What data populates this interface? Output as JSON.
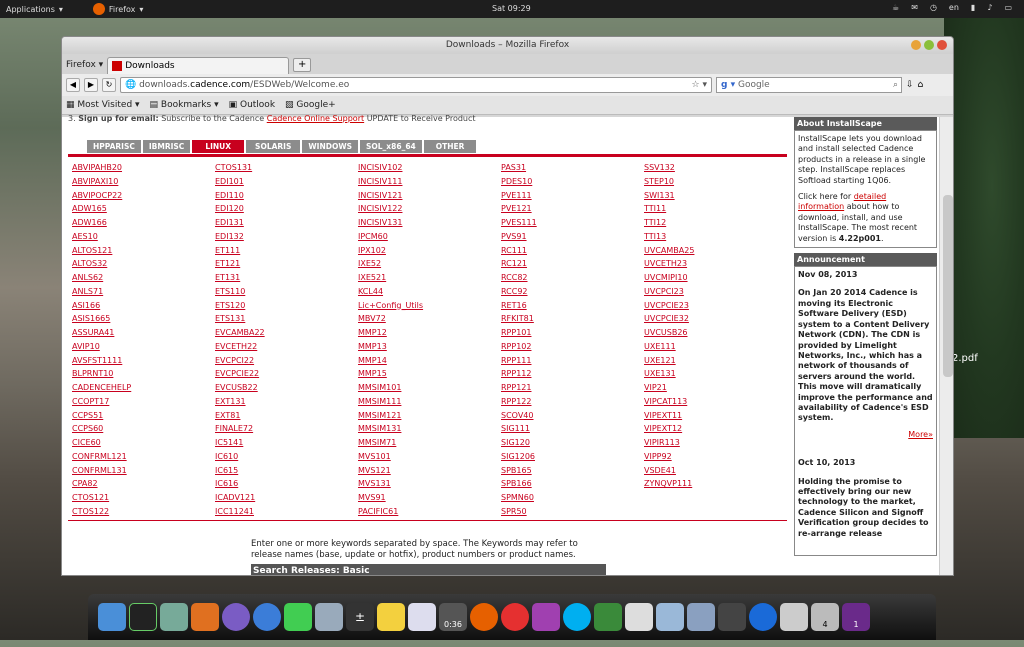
{
  "desktop": {
    "applications": "Applications",
    "firefox": "Firefox",
    "clock": "Sat 09:29",
    "lang": "en",
    "pdf_label": "2.pdf"
  },
  "window": {
    "title": "Downloads – Mozilla Firefox"
  },
  "browser": {
    "menu": "Firefox",
    "tab_title": "Downloads",
    "url_prefix": "downloads.",
    "url_domain": "cadence.com",
    "url_path": "/ESDWeb/Welcome.eo",
    "search_placeholder": "Google"
  },
  "bookmarks": [
    "Most Visited",
    "Bookmarks",
    "Outlook",
    "Google+"
  ],
  "page": {
    "snippet_num": "3.",
    "snippet_bold": "Sign up for email:",
    "snippet_text": "Subscribe to the Cadence",
    "snippet_link": "Cadence Online Support",
    "snippet_end": "UPDATE to Receive Product",
    "os_tabs": [
      "HPPARISC",
      "IBMRISC",
      "LINUX",
      "SOLARIS",
      "WINDOWS",
      "SOL_x86_64",
      "OTHER"
    ],
    "columns": [
      [
        "ABVIPAHB20",
        "ABVIPAXI10",
        "ABVIPOCP22",
        "ADW165",
        "ADW166",
        "AES10",
        "ALTOS121",
        "ALTOS32",
        "ANLS62",
        "ANLS71",
        "ASI166",
        "ASIS1665",
        "ASSURA41",
        "AVIP10",
        "AVSFST1111",
        "BLPRNT10",
        "CADENCEHELP",
        "CCOPT17",
        "CCPS51",
        "CCPS60",
        "CICE60",
        "CONFRML121",
        "CONFRML131",
        "CPA82",
        "CTOS121",
        "CTOS122"
      ],
      [
        "CTOS131",
        "EDI101",
        "EDI110",
        "EDI120",
        "EDI131",
        "EDI132",
        "ET111",
        "ET121",
        "ET131",
        "ETS110",
        "ETS120",
        "ETS131",
        "EVCAMBA22",
        "EVCETH22",
        "EVCPCI22",
        "EVCPCIE22",
        "EVCUSB22",
        "EXT131",
        "EXT81",
        "FINALE72",
        "IC5141",
        "IC610",
        "IC615",
        "IC616",
        "ICADV121",
        "ICC11241"
      ],
      [
        "INCISIV102",
        "INCISIV111",
        "INCISIV121",
        "INCISIV122",
        "INCISIV131",
        "IPCM60",
        "IPX102",
        "IXE52",
        "IXE521",
        "KCL44",
        "Lic+Config_Utils",
        "MBV72",
        "MMP12",
        "MMP13",
        "MMP14",
        "MMP15",
        "MMSIM101",
        "MMSIM111",
        "MMSIM121",
        "MMSIM131",
        "MMSIM71",
        "MVS101",
        "MVS121",
        "MVS131",
        "MVS91",
        "PACIFIC61"
      ],
      [
        "PAS31",
        "PDES10",
        "PVE111",
        "PVE121",
        "PVES111",
        "PVS91",
        "RC111",
        "RC121",
        "RCC82",
        "RCC92",
        "RET16",
        "RFKIT81",
        "RPP101",
        "RPP102",
        "RPP111",
        "RPP112",
        "RPP121",
        "RPP122",
        "SCOV40",
        "SIG111",
        "SIG120",
        "SIG1206",
        "SPB165",
        "SPB166",
        "SPMN60",
        "SPR50"
      ],
      [
        "SSV132",
        "STEP10",
        "SWI131",
        "TTI11",
        "TTI12",
        "TTI13",
        "UVCAMBA25",
        "UVCETH23",
        "UVCMIPI10",
        "UVCPCI23",
        "UVCPCIE23",
        "UVCPCIE32",
        "UVCUSB26",
        "UXE111",
        "UXE121",
        "UXE131",
        "VIP21",
        "VIPCAT113",
        "VIPEXT11",
        "VIPEXT12",
        "VIPIR113",
        "VIPP92",
        "VSDE41",
        "ZYNQVP111"
      ]
    ],
    "help_text": "Enter one or more keywords separated by space. The Keywords may refer to release names (base, update or hotfix), product numbers or product names.",
    "search_header": "Search Releases: Basic"
  },
  "sidebar": {
    "about_title": "About InstallScape",
    "about_text": "InstallScape lets you download and install selected Cadence products in a release in a single step. InstallScape replaces Softload starting 1Q06.",
    "click_pre": "Click here for ",
    "click_link": "detailed information",
    "click_post": " about how to download, install, and use InstallScape. The most recent version is ",
    "version": "4.22p001",
    "ann_title": "Announcement",
    "date1": "Nov 08, 2013",
    "ann1": "On Jan 20 2014 Cadence is moving its Electronic Software Delivery (ESD) system to a Content Delivery Network (CDN). The CDN is provided by Limelight Networks, Inc., which has a network of thousands of servers around the world. This move will dramatically improve the performance and availability of Cadence's ESD system.",
    "more": "More»",
    "date2": "Oct 10, 2013",
    "ann2": "Holding the promise to effectively bring our new technology to the market, Cadence Silicon and Signoff Verification group decides to re-arrange release"
  },
  "dock": {
    "timer": "0:36",
    "badge4": "4",
    "badge1": "1"
  }
}
